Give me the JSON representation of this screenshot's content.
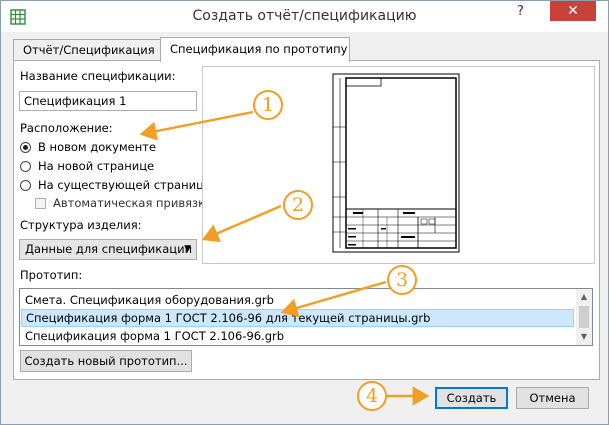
{
  "window": {
    "title": "Создать отчёт/спецификацию",
    "help_button": "?",
    "close_button": "✕"
  },
  "tabs": [
    {
      "label": "Отчёт/Спецификация",
      "active": false
    },
    {
      "label": "Спецификация по прототипу",
      "active": true
    }
  ],
  "form": {
    "name_label": "Название спецификации:",
    "name_value": "Спецификация 1",
    "location_label": "Расположение:",
    "location_options": [
      {
        "label": "В новом документе",
        "checked": true
      },
      {
        "label": "На новой странице",
        "checked": false
      },
      {
        "label": "На существующей странице",
        "checked": false
      }
    ],
    "auto_binding_label": "Автоматическая привязка",
    "auto_binding_checked": false,
    "structure_label": "Структура изделия:",
    "structure_value": "Данные для спецификации"
  },
  "prototype": {
    "label": "Прототип:",
    "items": [
      {
        "label": "Смета. Спецификация оборудования.grb",
        "selected": false
      },
      {
        "label": "Спецификация форма 1 ГОСТ 2.106-96 для текущей страницы.grb",
        "selected": true
      },
      {
        "label": "Спецификация форма 1 ГОСТ 2.106-96.grb",
        "selected": false
      }
    ],
    "new_prototype_button": "Создать новый прототип..."
  },
  "footer": {
    "create_button": "Создать",
    "cancel_button": "Отмена"
  },
  "callouts": [
    "1",
    "2",
    "3",
    "4"
  ],
  "colors": {
    "accent_orange": "#f29d23",
    "close_red": "#c9413b",
    "selection": "#cce8ff"
  }
}
